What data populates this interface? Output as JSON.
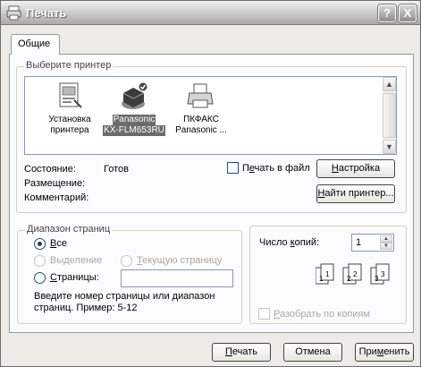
{
  "window": {
    "title": "Печать"
  },
  "titlebar": {
    "help_label": "?",
    "close_label": "X"
  },
  "tabs": [
    {
      "label": "Общие"
    }
  ],
  "printer_section": {
    "legend": "Выберите принтер",
    "printers": [
      {
        "line1": "Установка",
        "line2": "принтера",
        "selected": false,
        "icon": "add-printer-icon"
      },
      {
        "line1": "Panasonic",
        "line2": "KX-FLM653RU",
        "selected": true,
        "icon": "default-printer-icon"
      },
      {
        "line1": "ПКФАКС",
        "line2": "Panasonic ...",
        "selected": false,
        "icon": "printer-icon"
      }
    ]
  },
  "status": {
    "state_label": "Состояние:",
    "state_value": "Готов",
    "location_label": "Размещение:",
    "comment_label": "Комментарий:"
  },
  "print_to_file": {
    "pre": "П",
    "underlined": "е",
    "post": "чать в файл"
  },
  "settings_button": {
    "underlined": "Н",
    "post": "астройка"
  },
  "find_button": {
    "underlined": "Н",
    "post": "айти принтер..."
  },
  "range_section": {
    "legend": "Диапазон страниц",
    "all": {
      "underlined": "В",
      "post": "се"
    },
    "selection": {
      "pre": "Вы",
      "underlined": "д",
      "post": "еление"
    },
    "current_page": {
      "underlined": "Т",
      "post": "екущую страницу"
    },
    "pages": {
      "underlined": "С",
      "post": "траницы:"
    },
    "pages_value": "",
    "hint": "Введите номер страницы или диапазон страниц.  Пример: 5-12"
  },
  "copies": {
    "label_pre": "Число ",
    "label_underlined": "к",
    "label_post": "опий:",
    "value": "1",
    "collate": {
      "underlined": "Р",
      "post": "азобрать по копиям"
    },
    "art_numbers": [
      "1",
      "1",
      "2",
      "2",
      "3",
      "3"
    ]
  },
  "buttons": {
    "print": {
      "underlined": "П",
      "post": "ечать"
    },
    "cancel": "Отмена",
    "apply": {
      "pre": "При",
      "underlined": "м",
      "post": "енить"
    }
  }
}
